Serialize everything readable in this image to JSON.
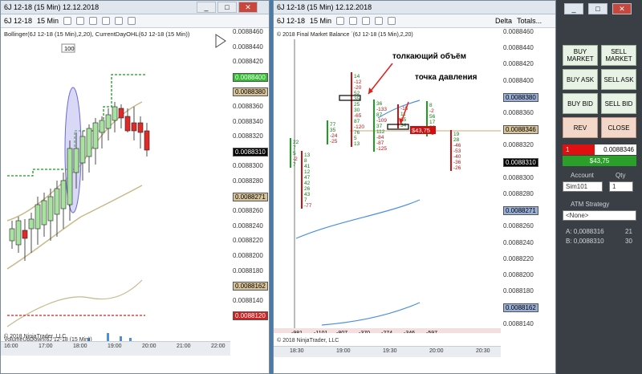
{
  "left_window": {
    "title": "6J 12-18 (15 Min) 12.12.2018",
    "instrument": "6J 12-18",
    "interval": "15 Min",
    "indicator_label": "Bollinger(6J 12-18 (15 Min),2,20), CurrentDayOHL(6J 12-18 (15 Min))",
    "bar_count": "100",
    "footer": "© 2018 NinjaTrader, LLC",
    "volume_label": "VolumeUpDown(6J 12-18 (15 Min))",
    "price_ticks": [
      "0.0088460",
      "0.0088440",
      "0.0088420",
      "0.0088400",
      "0.0088380",
      "0.0088360",
      "0.0088340",
      "0.0088320",
      "0.0088310",
      "0.0088300",
      "0.0088280",
      "0.0088271",
      "0.0088260",
      "0.0088240",
      "0.0088220",
      "0.0088200",
      "0.0088180",
      "0.0088162",
      "0.0088140",
      "0.0088120"
    ],
    "time_ticks": [
      "16:00",
      "17:00",
      "18:00",
      "19:00",
      "20:00",
      "21:00",
      "22:00"
    ],
    "highlight_prices": {
      "green": "0.0088400",
      "tan": "0.0088380",
      "black": "0.0088310",
      "tan2": "0.0088271",
      "tan3": "0.0088162",
      "red": "0.0088120"
    },
    "colors": {
      "bull": "#a8e2a0",
      "bear": "#e02a2a",
      "band": "#c8b98a",
      "ellipse": "#9a9ae0"
    }
  },
  "right_window": {
    "title": "6J 12-18 (15 Min) 12.12.2018",
    "instrument": "6J 12-18",
    "interval": "15 Min",
    "delta_label": "Delta",
    "totals_label": "Totals...",
    "indicator_label": "© 2018 Final Market Balance ´(6J 12-18 (15 Min),2,20)",
    "annotation_volume": "толкающий объём",
    "annotation_pressure": "точка давления",
    "footer": "© 2018 NinjaTrader, LLC",
    "price_ticks": [
      "0.0088460",
      "0.0088440",
      "0.0088420",
      "0.0088400",
      "0.0088380",
      "0.0088360",
      "0.0088346",
      "0.0088320",
      "0.0088310",
      "0.0088300",
      "0.0088280",
      "0.0088271",
      "0.0088260",
      "0.0088240",
      "0.0088220",
      "0.0088200",
      "0.0088180",
      "0.0088162",
      "0.0088140"
    ],
    "time_ticks": [
      "18:30",
      "19:00",
      "19:30",
      "20:00",
      "20:30"
    ],
    "deltas": [
      "-981",
      "-1101",
      "-807",
      "-370",
      "-274",
      "-346",
      "-597"
    ],
    "footprint_cols": [
      {
        "vals": [
          "22",
          "7",
          "5",
          "-2",
          "7"
        ]
      },
      {
        "vals": [
          "13",
          "8",
          "41",
          "12",
          "47",
          "42",
          "26",
          "43",
          "7",
          "-77"
        ]
      },
      {
        "vals": [
          "77",
          "35",
          "-24",
          "-25"
        ]
      },
      {
        "vals": [
          "14",
          "-12",
          "-20",
          "52",
          "35",
          "25",
          "30",
          "-65",
          "87",
          "-120",
          "76",
          "5",
          "13"
        ]
      },
      {
        "vals": [
          "36",
          "-133",
          "87",
          "-109",
          "37",
          "112",
          "-84",
          "-87",
          "-125"
        ]
      },
      {
        "vals": [
          "-15",
          "11",
          "15",
          "34"
        ]
      },
      {
        "vals": [
          "8",
          "-2",
          "56",
          "17",
          "36",
          "-1"
        ]
      },
      {
        "vals": [
          "19",
          "28",
          "-46",
          "-53",
          "-40",
          "-36",
          "-26"
        ]
      }
    ],
    "price_box": "$43,75"
  },
  "order_panel": {
    "buy_market": "BUY MARKET",
    "sell_market": "SELL MARKET",
    "buy_ask": "BUY ASK",
    "sell_ask": "SELL ASK",
    "buy_bid": "BUY BID",
    "sell_bid": "SELL BID",
    "rev": "REV",
    "close": "CLOSE",
    "position_qty": "1",
    "position_price": "0.0088346",
    "pnl": "$43,75",
    "account_label": "Account",
    "qty_label": "Qty",
    "account_value": "Sim101",
    "qty_value": "1",
    "atm_label": "ATM Strategy",
    "atm_value": "<None>",
    "ask_label": "A: 0,0088316",
    "ask_size": "21",
    "bid_label": "B: 0,0088310",
    "bid_size": "30"
  }
}
